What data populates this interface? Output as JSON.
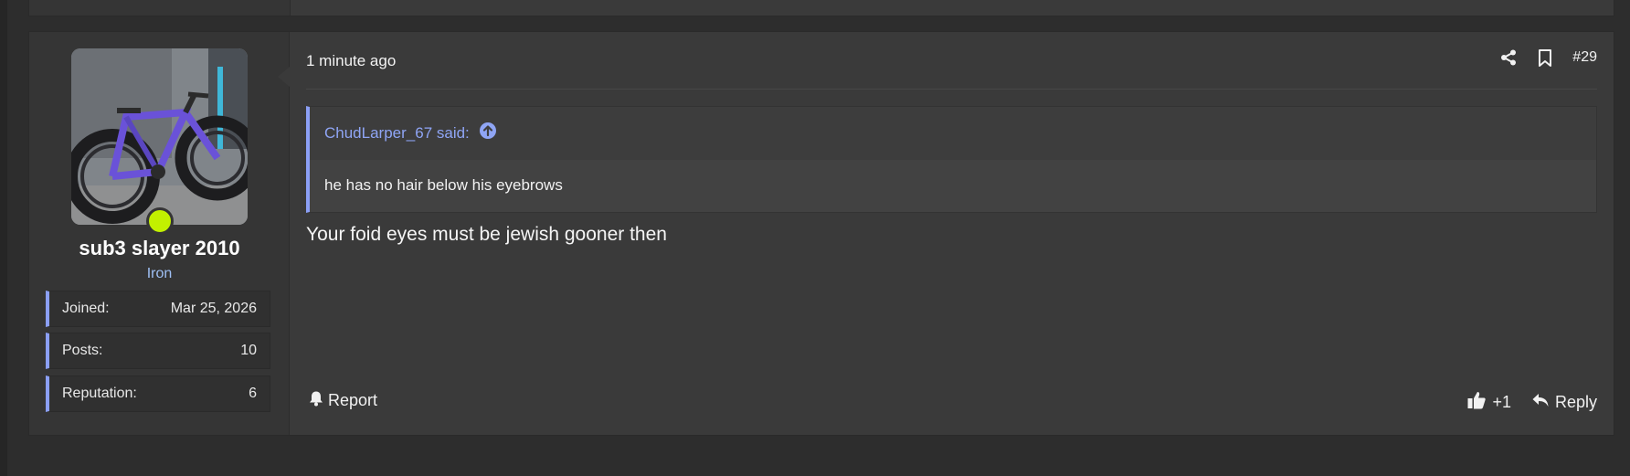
{
  "post": {
    "timestamp": "1 minute ago",
    "post_number": "#29",
    "message": "Your foid eyes must be jewish gooner then",
    "quote": {
      "author_said": "ChudLarper_67 said:",
      "text": "he has no hair below his eyebrows"
    },
    "actions": {
      "report_label": "Report",
      "like_label": "+1",
      "reply_label": "Reply"
    },
    "icons": {
      "share": "share-icon",
      "bookmark": "bookmark-icon",
      "quote_link": "arrow-up-circle-icon",
      "report": "bell-icon",
      "like": "thumbs-up-icon",
      "reply": "reply-icon"
    }
  },
  "user": {
    "name": "sub3 slayer 2010",
    "title": "Iron",
    "online_status_color": "#c2f000",
    "stats": [
      {
        "label": "Joined:",
        "value": "Mar 25, 2026"
      },
      {
        "label": "Posts:",
        "value": "10"
      },
      {
        "label": "Reputation:",
        "value": "6"
      }
    ]
  },
  "colors": {
    "accent": "#8b9ff5",
    "quote_link": "#8fa5f5",
    "background": "#2d2d2d",
    "post_bg": "#3a3a3a"
  }
}
